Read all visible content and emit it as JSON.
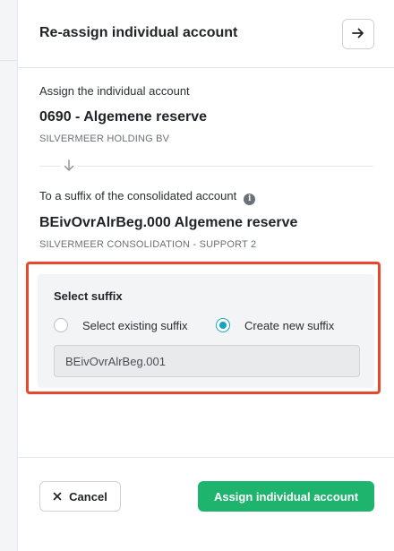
{
  "header": {
    "title": "Re-assign individual account",
    "close_icon": "arrow-right-icon"
  },
  "source": {
    "label": "Assign the individual account",
    "account": "0690 - Algemene reserve",
    "entity": "SILVERMEER HOLDING BV"
  },
  "arrow_icon": "arrow-down-icon",
  "target": {
    "label": "To a suffix of the consolidated account",
    "info_icon": "info-icon",
    "account": "BEivOvrAlrBeg.000 Algemene reserve",
    "entity": "SILVERMEER CONSOLIDATION - SUPPORT 2"
  },
  "suffix": {
    "title": "Select suffix",
    "options": [
      {
        "label": "Select existing suffix",
        "selected": false
      },
      {
        "label": "Create new suffix",
        "selected": true
      }
    ],
    "new_suffix_value": "BEivOvrAlrBeg.001"
  },
  "footer": {
    "cancel_label": "Cancel",
    "assign_label": "Assign individual account"
  },
  "colors": {
    "accent": "#1fb46e",
    "radio": "#14a3c0",
    "highlight": "#e8472c"
  }
}
